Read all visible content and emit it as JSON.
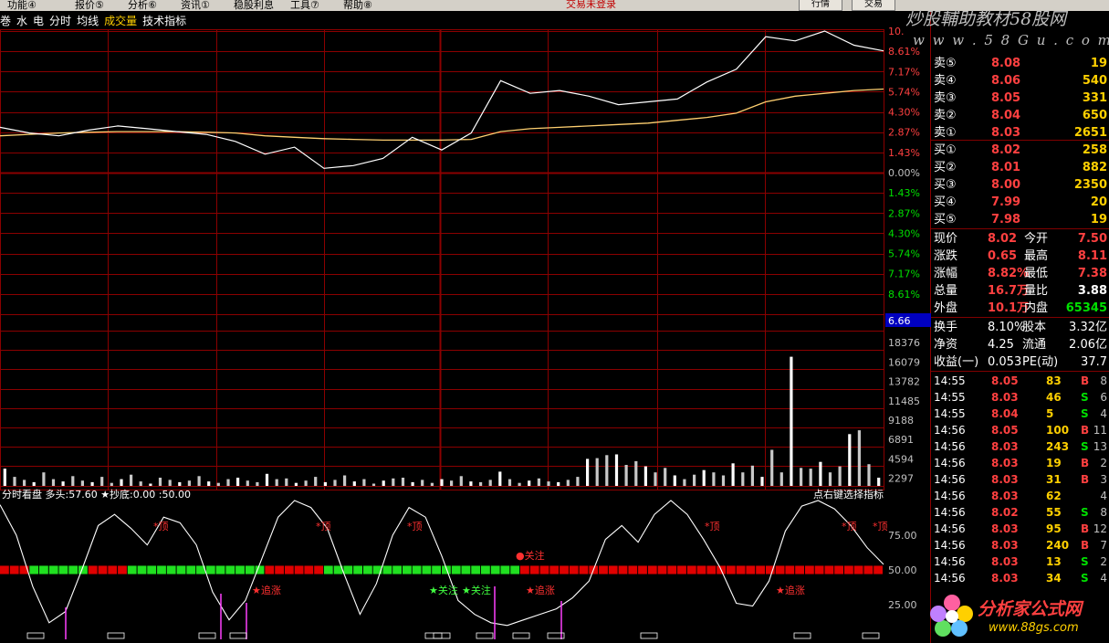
{
  "menu": {
    "items": [
      "功能④",
      "报价⑤",
      "分析⑥",
      "资讯①",
      "稳股利息",
      "工具⑦",
      "帮助⑧"
    ],
    "center_title": "交易未登录",
    "btn1": "行情",
    "btn2": "交易"
  },
  "watermark": {
    "line1": "炒股輔助教材58股网",
    "line2": "w w w . 5 8 G u . c o m"
  },
  "toolbar": {
    "items": [
      "巻",
      "水",
      "电"
    ],
    "fenshi": "分时",
    "junxian": "均线",
    "volume": "成交量",
    "indicator": "技术指标"
  },
  "indicator_header": {
    "left": "分时看盘  多头:57.60  ★抄底:0.00  :50.00",
    "right": "点右键选择指标"
  },
  "price_axis_labels": [
    "10.",
    "8.61%",
    "7.17%",
    "5.74%",
    "4.30%",
    "2.87%",
    "1.43%",
    "0.00%",
    "1.43%",
    "2.87%",
    "4.30%",
    "5.74%",
    "7.17%",
    "8.61%"
  ],
  "current_price_tag": "6.66",
  "volume_axis_labels": [
    "18376",
    "16079",
    "13782",
    "11485",
    "9188",
    "6891",
    "4594",
    "2297"
  ],
  "indicator_axis_labels": [
    "75.00",
    "50.00",
    "25.00"
  ],
  "chart_data": [
    {
      "type": "line",
      "title": "",
      "y_axis_labels": [
        "10.",
        "8.61%",
        "7.17%",
        "5.74%",
        "4.30%",
        "2.87%",
        "1.43%",
        "0.00%",
        "1.43%",
        "2.87%",
        "4.30%",
        "5.74%",
        "7.17%",
        "8.61%"
      ],
      "ylim": [
        -10.0,
        10.0
      ],
      "x": [
        0,
        8,
        16,
        24,
        32,
        40,
        48,
        56,
        64,
        72,
        80,
        88,
        96,
        104,
        112,
        120,
        128,
        136,
        144,
        152,
        160,
        168,
        176,
        184,
        192,
        200,
        208,
        216,
        224,
        232,
        240
      ],
      "series": [
        {
          "values": [
            3.2,
            2.8,
            2.6,
            3.0,
            3.3,
            3.1,
            2.9,
            2.7,
            2.2,
            1.3,
            1.8,
            0.3,
            0.5,
            1.0,
            2.5,
            1.6,
            2.8,
            6.5,
            5.6,
            5.8,
            5.4,
            4.8,
            5.0,
            5.2,
            6.4,
            7.3,
            9.6,
            9.3,
            10.0,
            9.0,
            8.6
          ]
        },
        {
          "values": [
            2.6,
            2.7,
            2.8,
            2.85,
            2.9,
            2.9,
            2.9,
            2.85,
            2.8,
            2.6,
            2.5,
            2.4,
            2.35,
            2.3,
            2.3,
            2.3,
            2.35,
            2.9,
            3.1,
            3.2,
            3.3,
            3.4,
            3.5,
            3.7,
            3.9,
            4.2,
            5.0,
            5.4,
            5.6,
            5.8,
            5.9
          ]
        }
      ]
    },
    {
      "type": "bar",
      "title": "",
      "y_axis_labels": [
        "18376",
        "16079",
        "13782",
        "11485",
        "9188",
        "6891",
        "4594",
        "2297"
      ],
      "ylim": [
        0,
        20673
      ],
      "values": [
        2300,
        1200,
        800,
        500,
        1800,
        900,
        600,
        1300,
        700,
        500,
        1200,
        400,
        900,
        1500,
        600,
        300,
        1100,
        800,
        500,
        700,
        1300,
        600,
        400,
        900,
        1100,
        700,
        500,
        1600,
        900,
        1000,
        400,
        700,
        1200,
        500,
        800,
        1400,
        600,
        900,
        300,
        700,
        1000,
        1100,
        500,
        800,
        400,
        900,
        700,
        1300,
        600,
        500,
        800,
        1900,
        900,
        400,
        700,
        1000,
        600,
        500,
        800,
        1200,
        3600,
        3700,
        4100,
        4200,
        2800,
        3300,
        2600,
        1800,
        2400,
        1400,
        900,
        1500,
        2100,
        1800,
        1400,
        3000,
        1800,
        2700,
        1200,
        4800,
        1800,
        17200,
        2400,
        2300,
        3200,
        1800,
        2600,
        6900,
        7400,
        2900,
        1100
      ]
    },
    {
      "type": "line",
      "title": "",
      "y_axis_labels": [
        "75.00",
        "50.00",
        "25.00"
      ],
      "ylim": [
        0,
        100
      ],
      "series": [
        {
          "values": [
            97,
            75,
            38,
            12,
            20,
            50,
            82,
            90,
            80,
            68,
            88,
            84,
            68,
            34,
            14,
            28,
            58,
            88,
            100,
            95,
            80,
            48,
            18,
            40,
            75,
            95,
            88,
            60,
            28,
            18,
            12,
            10,
            14,
            18,
            22,
            30,
            42,
            72,
            82,
            70,
            90,
            100,
            90,
            72,
            52,
            26,
            24,
            42,
            78,
            96,
            100,
            94,
            82,
            66,
            54
          ]
        }
      ],
      "signal_labels": [
        "*顶",
        "*顶",
        "*顶",
        "★追涨",
        "★关注",
        "★关注",
        "★追涨",
        "●关注",
        "*顶",
        "★追涨",
        "*顶",
        "*顶"
      ]
    }
  ],
  "quote": {
    "sell": [
      {
        "label": "卖⑤",
        "price": "8.08",
        "vol": "19"
      },
      {
        "label": "卖④",
        "price": "8.06",
        "vol": "540"
      },
      {
        "label": "卖③",
        "price": "8.05",
        "vol": "331"
      },
      {
        "label": "卖②",
        "price": "8.04",
        "vol": "650"
      },
      {
        "label": "卖①",
        "price": "8.03",
        "vol": "2651"
      }
    ],
    "buy": [
      {
        "label": "买①",
        "price": "8.02",
        "vol": "258"
      },
      {
        "label": "买②",
        "price": "8.01",
        "vol": "882"
      },
      {
        "label": "买③",
        "price": "8.00",
        "vol": "2350"
      },
      {
        "label": "买④",
        "price": "7.99",
        "vol": "20"
      },
      {
        "label": "买⑤",
        "price": "7.98",
        "vol": "19"
      }
    ],
    "stats": [
      {
        "l1": "现价",
        "v1": "8.02",
        "l2": "今开",
        "v2": "7.50"
      },
      {
        "l1": "涨跌",
        "v1": "0.65",
        "l2": "最高",
        "v2": "8.11"
      },
      {
        "l1": "涨幅",
        "v1": "8.82%",
        "l2": "最低",
        "v2": "7.38"
      },
      {
        "l1": "总量",
        "v1": "16.7万",
        "l2": "量比",
        "v2": "3.88"
      },
      {
        "l1": "外盘",
        "v1": "10.1万",
        "l2": "内盘",
        "v2": "65345"
      }
    ],
    "stats2": [
      {
        "l1": "换手",
        "v1": "8.10%",
        "l2": "股本",
        "v2": "3.32亿"
      },
      {
        "l1": "净资",
        "v1": "4.25",
        "l2": "流通",
        "v2": "2.06亿"
      },
      {
        "l1": "收益(一)",
        "v1": "0.053",
        "l2": "PE(动)",
        "v2": "37.7"
      }
    ],
    "ticks": [
      {
        "t": "14:55",
        "p": "8.05",
        "v": "83",
        "s": "B",
        "n": "8"
      },
      {
        "t": "14:55",
        "p": "8.03",
        "v": "46",
        "s": "S",
        "n": "6"
      },
      {
        "t": "14:55",
        "p": "8.04",
        "v": "5",
        "s": "S",
        "n": "4"
      },
      {
        "t": "14:56",
        "p": "8.05",
        "v": "100",
        "s": "B",
        "n": "11"
      },
      {
        "t": "14:56",
        "p": "8.03",
        "v": "243",
        "s": "S",
        "n": "13"
      },
      {
        "t": "14:56",
        "p": "8.03",
        "v": "19",
        "s": "B",
        "n": "2"
      },
      {
        "t": "14:56",
        "p": "8.03",
        "v": "31",
        "s": "B",
        "n": "3"
      },
      {
        "t": "14:56",
        "p": "8.03",
        "v": "62",
        "s": "",
        "n": "4"
      },
      {
        "t": "14:56",
        "p": "8.02",
        "v": "55",
        "s": "S",
        "n": "8"
      },
      {
        "t": "14:56",
        "p": "8.03",
        "v": "95",
        "s": "B",
        "n": "12"
      },
      {
        "t": "14:56",
        "p": "8.03",
        "v": "240",
        "s": "B",
        "n": "7"
      },
      {
        "t": "14:56",
        "p": "8.03",
        "v": "13",
        "s": "S",
        "n": "2"
      },
      {
        "t": "14:56",
        "p": "8.03",
        "v": "34",
        "s": "S",
        "n": "4"
      }
    ]
  },
  "logo": {
    "line1": "分析家公式网",
    "line2": "www.88gs.com"
  },
  "colors": {
    "grid": "#8b0000",
    "price": "#ffffff",
    "avg": "#ffd070",
    "up": "#ff4040",
    "down": "#00e000",
    "label": "#ff3030"
  }
}
